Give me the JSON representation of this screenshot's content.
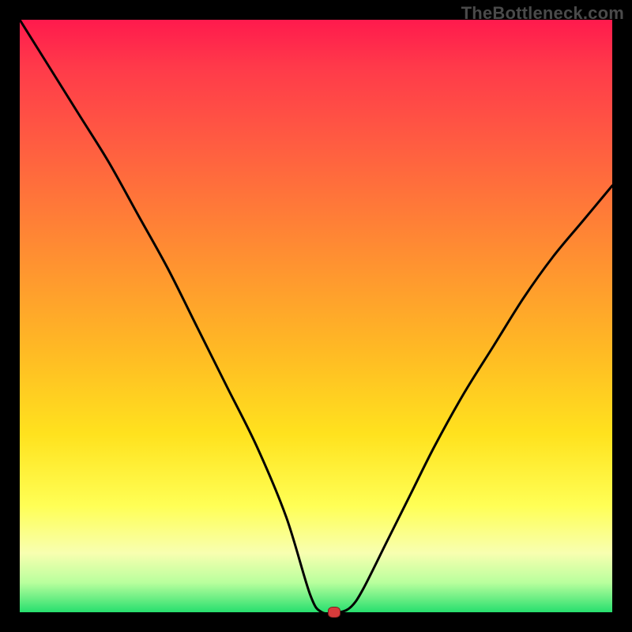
{
  "watermark": "TheBottleneck.com",
  "chart_data": {
    "type": "line",
    "title": "",
    "xlabel": "",
    "ylabel": "",
    "xlim": [
      0,
      100
    ],
    "ylim": [
      0,
      100
    ],
    "grid": false,
    "legend": false,
    "background": "rainbow-gradient-red-to-green",
    "marker": {
      "x": 53,
      "y": 0,
      "color": "#d63b3b",
      "shape": "rounded-rect"
    },
    "series": [
      {
        "name": "bottleneck-curve",
        "color": "#000000",
        "x": [
          0,
          5,
          10,
          15,
          20,
          25,
          30,
          35,
          40,
          45,
          49,
          51,
          54,
          56,
          58,
          62,
          66,
          70,
          75,
          80,
          85,
          90,
          95,
          100
        ],
        "values": [
          100,
          92,
          84,
          76,
          67,
          58,
          48,
          38,
          28,
          16,
          3,
          0,
          0,
          1,
          4,
          12,
          20,
          28,
          37,
          45,
          53,
          60,
          66,
          72
        ]
      }
    ]
  }
}
